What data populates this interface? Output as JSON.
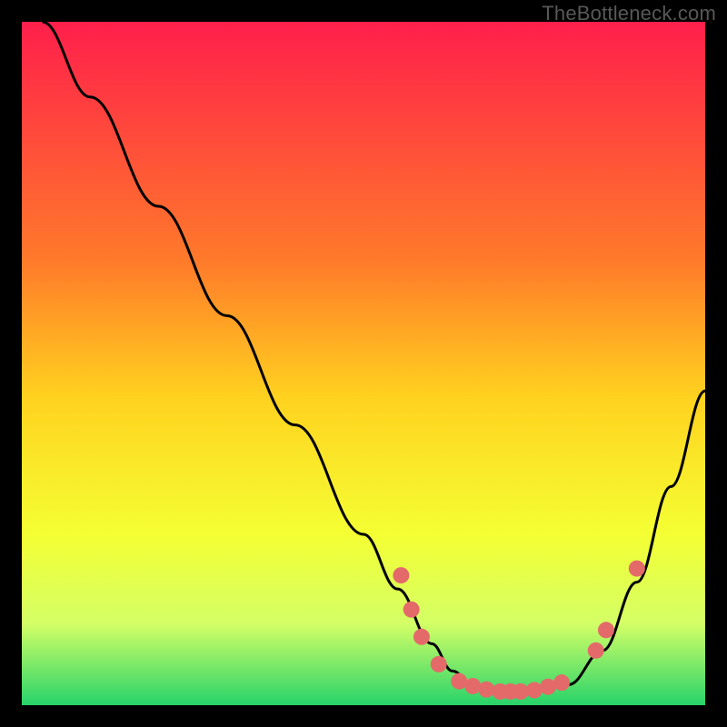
{
  "watermark": "TheBottleneck.com",
  "chart_data": {
    "type": "line",
    "title": "",
    "xlabel": "",
    "ylabel": "",
    "xlim": [
      0,
      100
    ],
    "ylim": [
      0,
      100
    ],
    "gradient_stops": [
      {
        "offset": 0,
        "color": "#ff1f4b"
      },
      {
        "offset": 35,
        "color": "#ff7a2a"
      },
      {
        "offset": 55,
        "color": "#ffd21f"
      },
      {
        "offset": 75,
        "color": "#f4ff33"
      },
      {
        "offset": 88,
        "color": "#d4ff66"
      },
      {
        "offset": 100,
        "color": "#27d36a"
      }
    ],
    "series": [
      {
        "name": "bottleneck-curve",
        "x": [
          3,
          10,
          20,
          30,
          40,
          50,
          55,
          60,
          63,
          66,
          70,
          75,
          80,
          85,
          90,
          95,
          100
        ],
        "y": [
          100,
          89,
          73,
          57,
          41,
          25,
          17,
          9,
          5,
          3,
          2,
          2,
          3,
          8,
          18,
          32,
          46
        ]
      }
    ],
    "scatter": {
      "name": "highlight-points",
      "color": "#e46a6a",
      "radius": 9,
      "points": [
        {
          "x": 55.5,
          "y": 19
        },
        {
          "x": 57.0,
          "y": 14
        },
        {
          "x": 58.5,
          "y": 10
        },
        {
          "x": 61.0,
          "y": 6
        },
        {
          "x": 64.0,
          "y": 3.5
        },
        {
          "x": 66.0,
          "y": 2.8
        },
        {
          "x": 68.0,
          "y": 2.3
        },
        {
          "x": 70.0,
          "y": 2.0
        },
        {
          "x": 71.5,
          "y": 2.0
        },
        {
          "x": 73.0,
          "y": 2.0
        },
        {
          "x": 75.0,
          "y": 2.2
        },
        {
          "x": 77.0,
          "y": 2.7
        },
        {
          "x": 79.0,
          "y": 3.3
        },
        {
          "x": 84.0,
          "y": 8
        },
        {
          "x": 85.5,
          "y": 11
        },
        {
          "x": 90.0,
          "y": 20
        }
      ]
    }
  }
}
